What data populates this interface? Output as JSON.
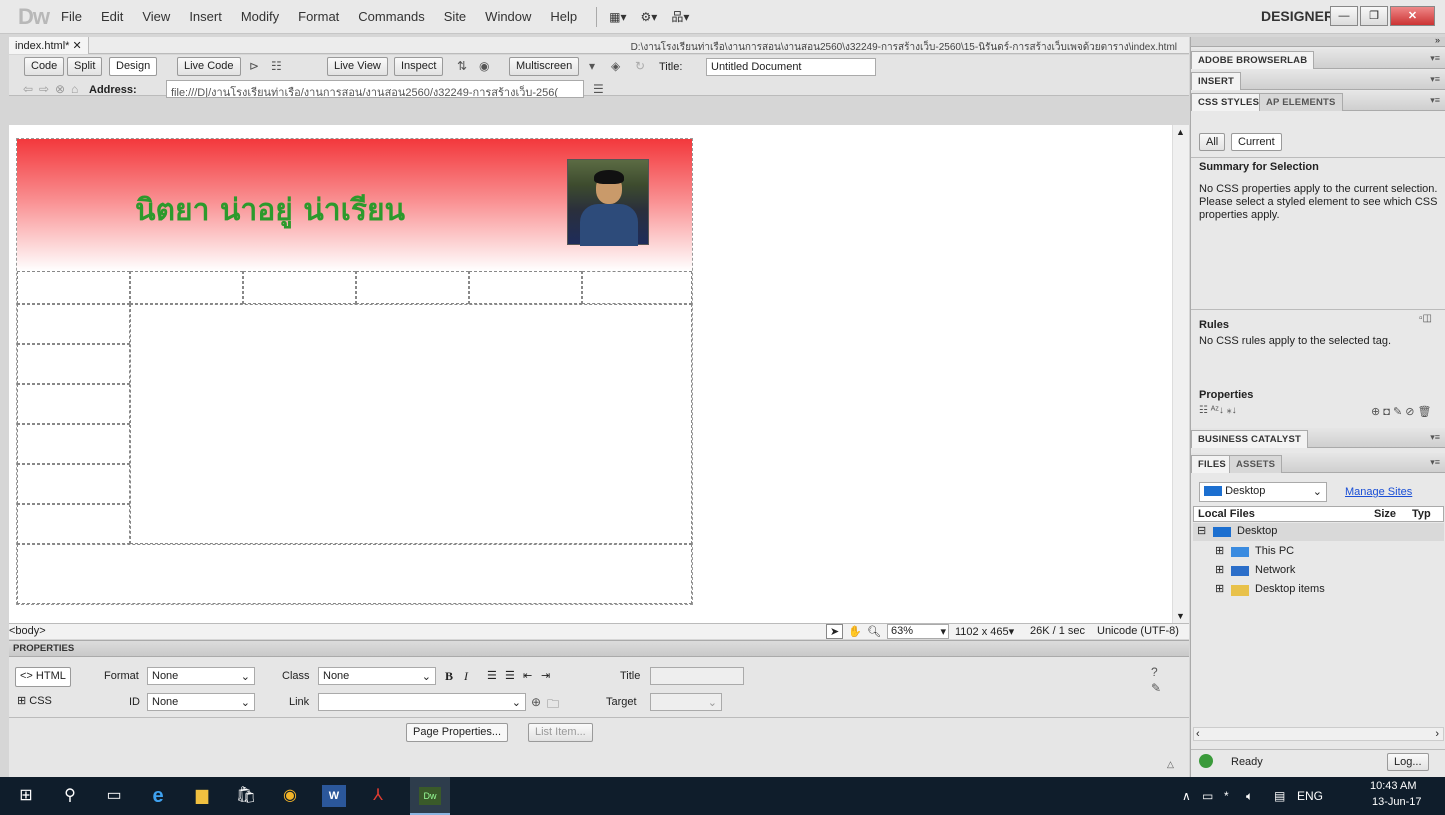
{
  "app": {
    "logo": "Dw",
    "workspace": "DESIGNER"
  },
  "menu": [
    "File",
    "Edit",
    "View",
    "Insert",
    "Modify",
    "Format",
    "Commands",
    "Site",
    "Window",
    "Help"
  ],
  "document": {
    "tab_label": "index.html*",
    "path": "D:\\งานโรงเรียนท่าเรือ\\งานการสอน\\งานสอน2560\\ง32249-การสร้างเว็บ-2560\\15-นิรันดร์-การสร้างเว็บเพจด้วยตาราง\\index.html"
  },
  "toolbar": {
    "code": "Code",
    "split": "Split",
    "design": "Design",
    "live_code": "Live Code",
    "live_view": "Live View",
    "inspect": "Inspect",
    "multiscreen": "Multiscreen",
    "title_label": "Title:",
    "title_value": "Untitled Document",
    "address_label": "Address:",
    "address_value": "file:///D|/งานโรงเรียนท่าเรือ/งานการสอน/งานสอน2560/ง32249-การสร้างเว็บ-256("
  },
  "page": {
    "banner_title": "นิตยา น่าอยู่ น่าเรียน"
  },
  "statusbar": {
    "tag": "<body>",
    "zoom": "63%",
    "size": "1102 x 465",
    "weight": "26K / 1 sec",
    "encoding": "Unicode (UTF-8)"
  },
  "properties": {
    "header": "PROPERTIES",
    "html_btn": "HTML",
    "css_btn": "CSS",
    "format_label": "Format",
    "format_value": "None",
    "id_label": "ID",
    "id_value": "None",
    "class_label": "Class",
    "class_value": "None",
    "link_label": "Link",
    "title_label": "Title",
    "target_label": "Target",
    "page_props": "Page Properties...",
    "list_item": "List Item..."
  },
  "panels": {
    "browserlab": "ADOBE BROWSERLAB",
    "insert": "INSERT",
    "css_styles": "CSS STYLES",
    "ap_elements": "AP ELEMENTS",
    "all": "All",
    "current": "Current",
    "summary_title": "Summary for Selection",
    "summary_text": "No CSS properties apply to the current selection.  Please select a styled element to see which CSS properties apply.",
    "rules_title": "Rules",
    "rules_text": "No CSS rules apply to the selected tag.",
    "properties_title": "Properties",
    "business": "BUSINESS CATALYST",
    "files": "FILES",
    "assets": "ASSETS",
    "site_select": "Desktop",
    "manage_sites": "Manage Sites",
    "col_local": "Local Files",
    "col_size": "Size",
    "col_type": "Typ",
    "tree": [
      "Desktop",
      "This PC",
      "Network",
      "Desktop items"
    ],
    "status": "Ready",
    "log": "Log..."
  },
  "taskbar": {
    "lang": "ENG",
    "time": "10:43 AM",
    "date": "13-Jun-17"
  }
}
